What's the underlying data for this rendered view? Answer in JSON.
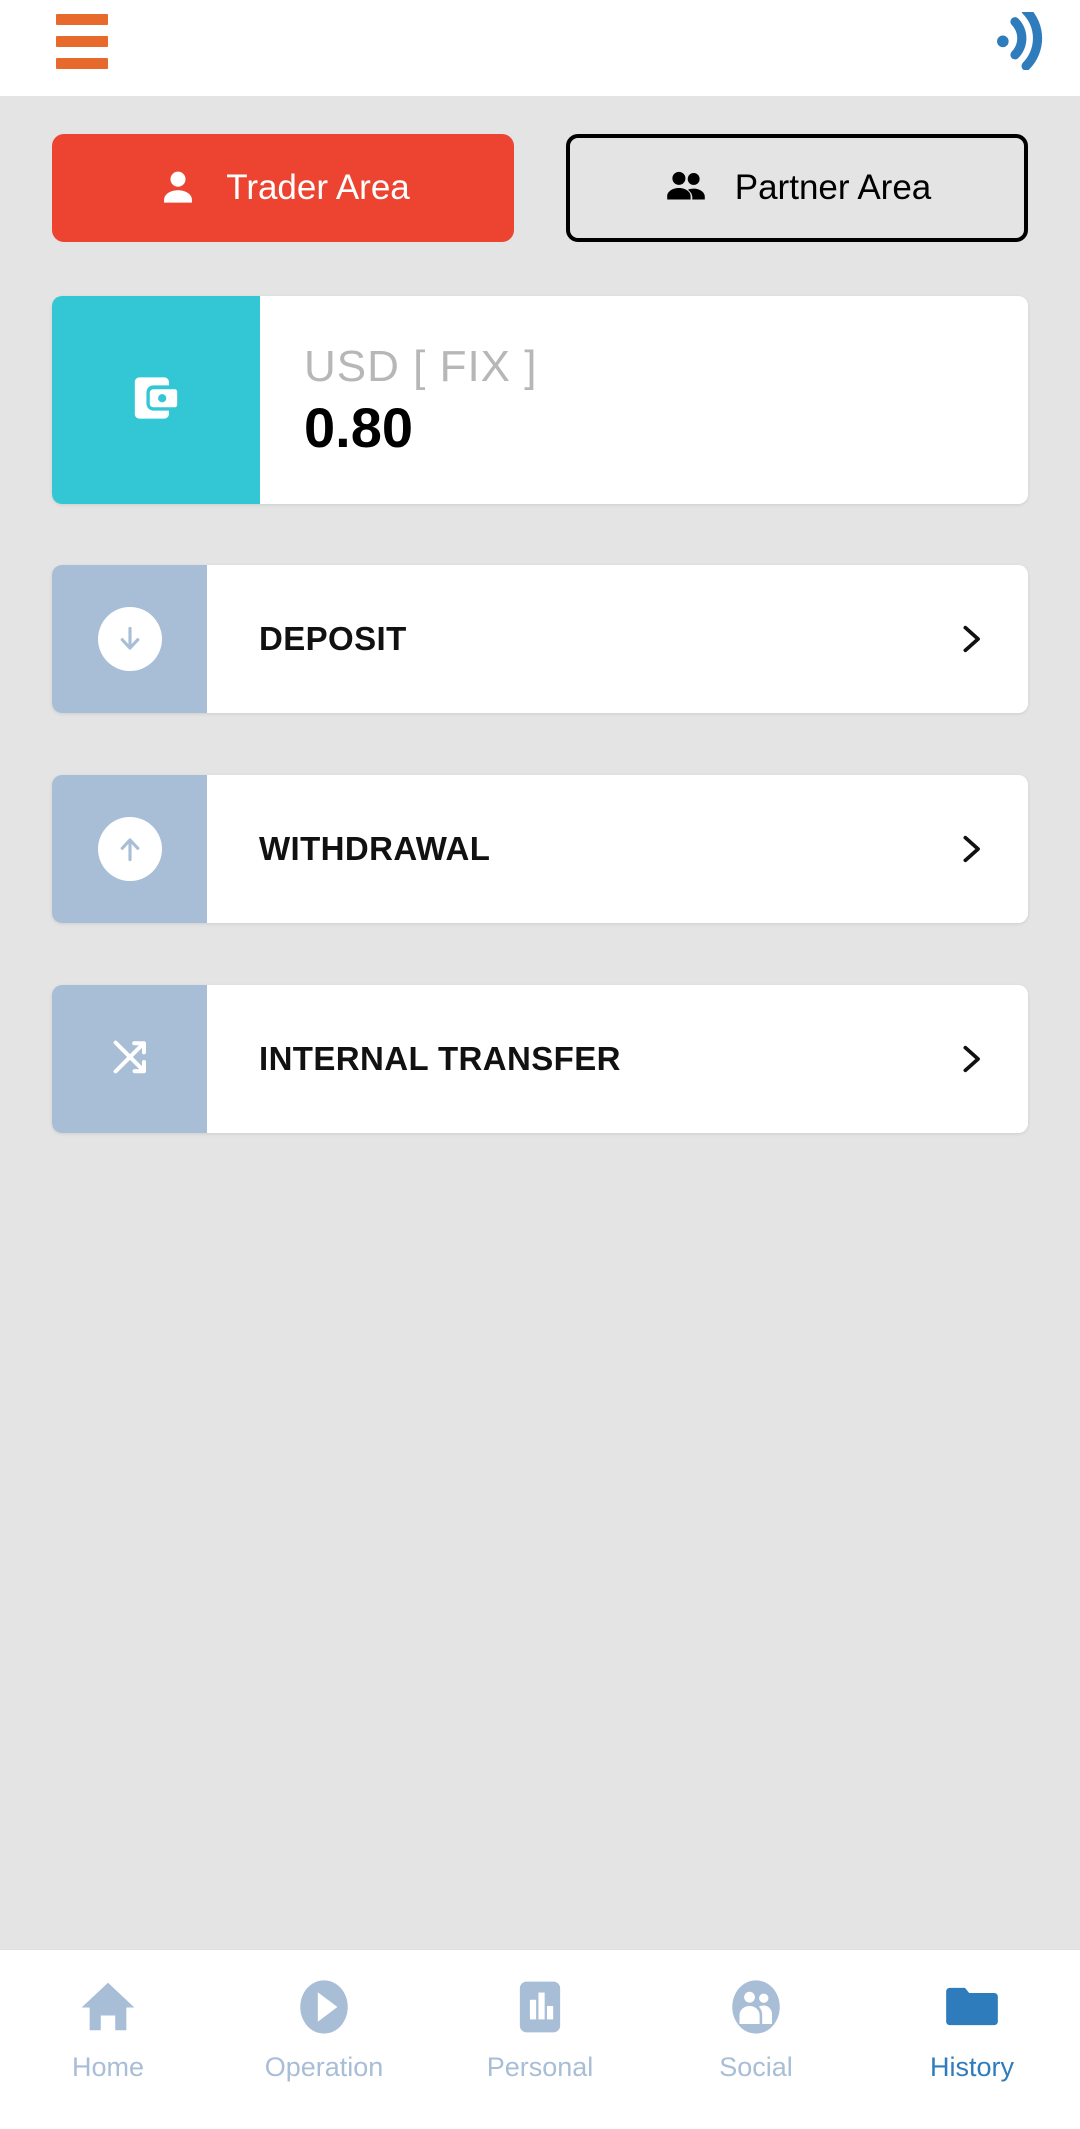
{
  "topbar": {
    "menu_icon": "hamburger-menu-icon",
    "signal_icon": "rss-signal-icon",
    "menu_color": "#e8692c",
    "signal_color": "#2f7cbd"
  },
  "area_tabs": [
    {
      "label": "Trader Area",
      "icon": "person-icon",
      "active": true,
      "bg": "#ec4431",
      "text_color": "#ffffff"
    },
    {
      "label": "Partner Area",
      "icon": "people-icon",
      "active": false,
      "bg": "transparent",
      "text_color": "#000000"
    }
  ],
  "balance": {
    "icon": "wallet-icon",
    "icon_bg": "#33c6d4",
    "currency": "USD [ FIX ]",
    "amount": "0.80"
  },
  "actions": [
    {
      "label": "DEPOSIT",
      "icon": "arrow-down-circle-icon",
      "chevron": "chevron-right-icon",
      "icon_bg": "#a8bdd6"
    },
    {
      "label": "WITHDRAWAL",
      "icon": "arrow-up-circle-icon",
      "chevron": "chevron-right-icon",
      "icon_bg": "#a8bdd6"
    },
    {
      "label": "INTERNAL TRANSFER",
      "icon": "shuffle-icon",
      "chevron": "chevron-right-icon",
      "icon_bg": "#a8bdd6"
    }
  ],
  "bottom_nav": {
    "active_color": "#2f7cbd",
    "inactive_color": "#a8bdd6",
    "items": [
      {
        "label": "Home",
        "icon": "home-icon",
        "active": false
      },
      {
        "label": "Operation",
        "icon": "play-circle-icon",
        "active": false
      },
      {
        "label": "Personal",
        "icon": "bar-chart-icon",
        "active": false
      },
      {
        "label": "Social",
        "icon": "people-circle-icon",
        "active": false
      },
      {
        "label": "History",
        "icon": "folder-icon",
        "active": true
      }
    ]
  }
}
